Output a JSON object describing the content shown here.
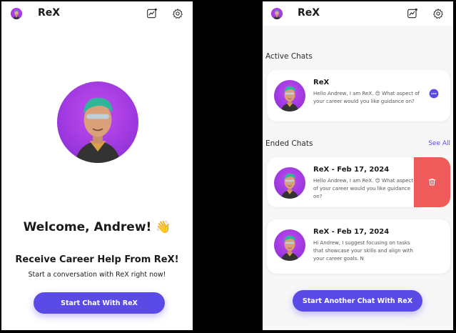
{
  "left": {
    "app_title": "ReX",
    "welcome": "Welcome, Andrew! 👋",
    "career_heading": "Receive Career Help From ReX!",
    "start_sub": "Start a conversation with ReX right now!",
    "start_button": "Start Chat With ReX"
  },
  "right": {
    "app_title": "ReX",
    "active_heading": "Active Chats",
    "ended_heading": "Ended Chats",
    "see_all": "See All",
    "active_chat": {
      "name": "ReX",
      "message": "Hello Andrew, I am ReX. 😊 What aspect of your career would you like guidance on?"
    },
    "ended_chats": [
      {
        "name": "ReX - Feb 17, 2024",
        "message": "Hello Andrew, I am ReX. 😊 What aspect of your career would you like guidance on?"
      },
      {
        "name": "ReX - Feb 17, 2024",
        "message": "Hi Andrew, I suggest focusing on tasks that showcase your skills and align with your career goals. N"
      }
    ],
    "start_button": "Start Another Chat With ReX"
  },
  "colors": {
    "accent": "#5a4be6",
    "delete": "#ef5b5b",
    "avatar_bg": "#b33fe0"
  },
  "icons": [
    "trend-icon",
    "gear-icon",
    "chat-bubble-icon",
    "trash-icon"
  ]
}
